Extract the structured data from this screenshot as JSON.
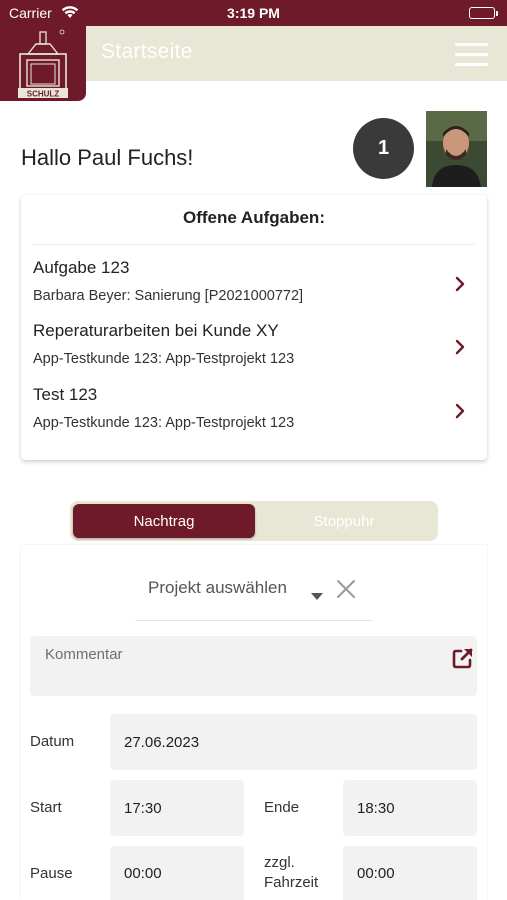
{
  "status_bar": {
    "carrier": "Carrier",
    "time": "3:19 PM"
  },
  "header": {
    "title": "Startseite",
    "logo_text": "SCHULZ"
  },
  "greeting": "Hallo Paul Fuchs!",
  "notifications": {
    "count": "1"
  },
  "tasks": {
    "title": "Offene Aufgaben:",
    "items": [
      {
        "title": "Aufgabe 123",
        "subtitle": "Barbara Beyer: Sanierung [P2021000772]"
      },
      {
        "title": "Reperaturarbeiten bei Kunde XY",
        "subtitle": "App-Testkunde 123: App-Testprojekt 123"
      },
      {
        "title": "Test 123",
        "subtitle": "App-Testkunde 123: App-Testprojekt 123"
      }
    ]
  },
  "segments": {
    "active": "Nachtrag",
    "inactive": "Stoppuhr"
  },
  "form": {
    "project_placeholder": "Projekt auswählen",
    "comment_placeholder": "Kommentar",
    "date_label": "Datum",
    "date_value": "27.06.2023",
    "start_label": "Start",
    "start_value": "17:30",
    "end_label": "Ende",
    "end_value": "18:30",
    "pause_label": "Pause",
    "pause_value": "00:00",
    "travel_label_line1": "zzgl.",
    "travel_label_line2": "Fahrzeit",
    "travel_value": "00:00"
  },
  "colors": {
    "brand": "#6f1a2a",
    "header_bg": "#e8e6d4",
    "input_bg": "#f2f2f2"
  },
  "icons": [
    "wifi-icon",
    "battery-icon",
    "schulz-logo",
    "hamburger-menu-icon",
    "chevron-right-icon",
    "caret-down-icon",
    "close-icon",
    "external-link-icon"
  ]
}
